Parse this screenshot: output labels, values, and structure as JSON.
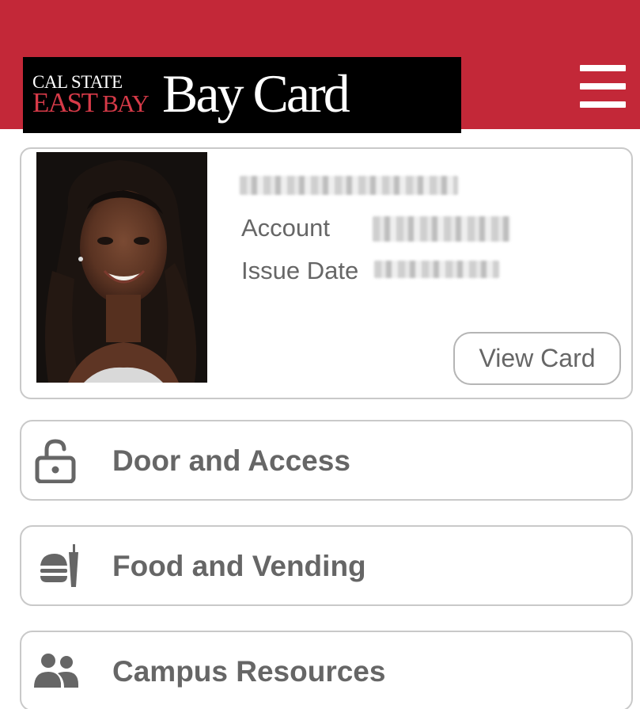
{
  "header": {
    "logo_line1": "CAL STATE",
    "logo_line2_a": "EAST",
    "logo_line2_b": "BAY",
    "logo_product": "Bay Card",
    "menu_icon": "hamburger-menu-icon",
    "background_color": "#c32838"
  },
  "profile": {
    "name": "",
    "account_label": "Account",
    "account_value": "",
    "issue_date_label": "Issue Date",
    "issue_date_value": "",
    "view_card_label": "View Card"
  },
  "menu": [
    {
      "label": "Door and Access",
      "icon": "padlock-icon"
    },
    {
      "label": "Food and Vending",
      "icon": "food-icon"
    },
    {
      "label": "Campus Resources",
      "icon": "people-icon"
    }
  ],
  "colors": {
    "brand_red": "#c32838",
    "text_gray": "#666666",
    "border_gray": "#c9c9c9"
  }
}
